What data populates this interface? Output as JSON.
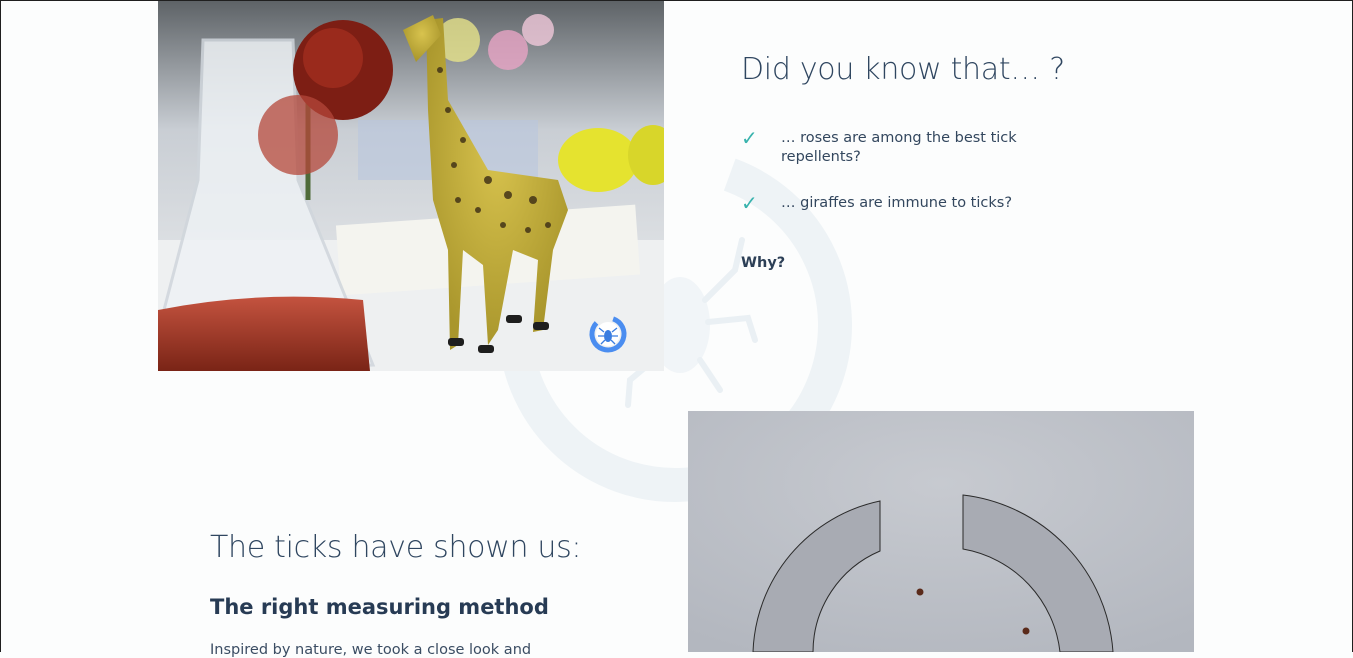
{
  "did_you_know": {
    "title": "Did you know that… ?",
    "facts": [
      {
        "icon": "check-icon",
        "check": "✓",
        "text": "… roses are among the best tick repellents?"
      },
      {
        "icon": "check-icon",
        "check": "✓",
        "text": "… giraffes are immune to ticks?"
      }
    ],
    "why_label": "Why?"
  },
  "ticks_section": {
    "title": "The ticks have shown us:",
    "subtitle": "The right measuring method",
    "intro": "Inspired by nature, we took a close look and"
  },
  "colors": {
    "accent": "#38b3ad",
    "heading": "#2f4660",
    "badge": "#4a8df0",
    "watermark": "#eef3f6"
  },
  "icons": {
    "photo_badge": "tick-logo-icon",
    "watermark": "tick-watermark-icon"
  }
}
